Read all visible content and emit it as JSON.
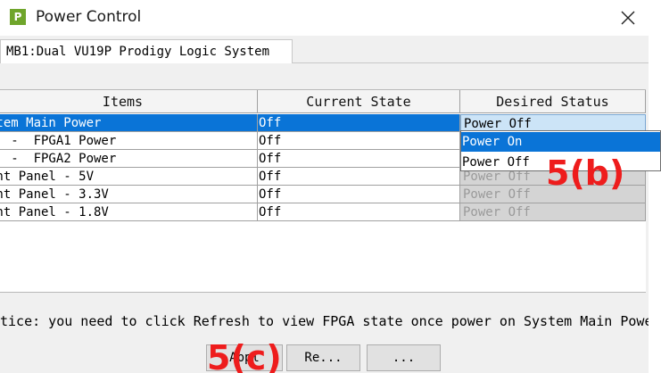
{
  "window": {
    "title": "Power Control",
    "icon_letter": "P"
  },
  "tab": {
    "label": "MB1:Dual VU19P Prodigy Logic System"
  },
  "table": {
    "headers": [
      "Items",
      "Current State",
      "Desired Status"
    ],
    "rows": [
      {
        "item": "stem Main Power",
        "current": "Off",
        "desired": "Power Off"
      },
      {
        "item": "   -  FPGA1 Power",
        "current": "Off",
        "desired": ""
      },
      {
        "item": "   -  FPGA2 Power",
        "current": "Off",
        "desired": ""
      },
      {
        "item": "ont Panel - 5V",
        "current": "Off",
        "desired": "Power Off"
      },
      {
        "item": "ont Panel - 3.3V",
        "current": "Off",
        "desired": "Power Off"
      },
      {
        "item": "ont Panel - 1.8V",
        "current": "Off",
        "desired": "Power Off"
      }
    ]
  },
  "dropdown": {
    "options": [
      "Power On",
      "Power Off"
    ]
  },
  "notice": "tice: you need to click Refresh to view FPGA state once power on System Main Powe",
  "buttons": {
    "apply": "Appl",
    "refresh": "Re...",
    "more": "..."
  },
  "annotations": {
    "b": "5(b)",
    "c": "5(c)"
  },
  "colors": {
    "selection": "#0a74d7",
    "annotation": "#ee1c1c",
    "app_icon": "#6fa52b"
  }
}
